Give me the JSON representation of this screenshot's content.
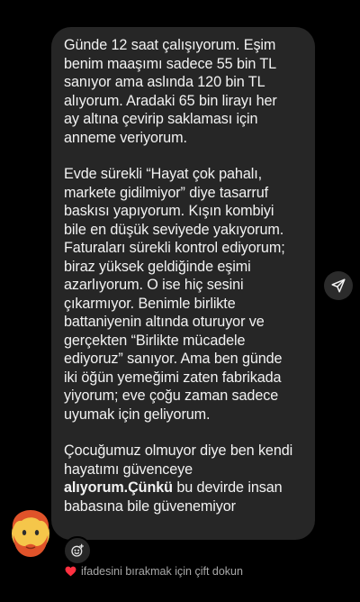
{
  "message": {
    "paragraph1": "Günde 12 saat çalışıyorum. Eşim benim maaşımı sadece 55 bin TL sanıyor ama aslında 120 bin TL alıyorum. Aradaki 65 bin lirayı her ay altına çevirip saklaması için anneme veriyorum.",
    "paragraph2": "Evde sürekli “Hayat çok pahalı, markete gidilmiyor” diye tasarruf baskısı yapıyorum. Kışın kombiyi bile en düşük seviyede yakıyorum. Faturaları sürekli kontrol ediyorum; biraz yüksek geldiğinde eşimi azarlıyorum. O ise hiç sesini çıkarmıyor. Benimle birlikte battaniyenin altında oturuyor ve gerçekten “Birlikte mücadele ediyoruz” sanıyor. Ama ben günde iki öğün yemeğimi zaten fabrikada yiyorum; eve çoğu zaman sadece uyumak için geliyorum.",
    "paragraph3_start": "Çocuğumuz olmuyor diye ben kendi hayatımı güvenceye ",
    "paragraph3_bold": "alıyorum.Çünkü",
    "paragraph3_end": " bu devirde insan babasına bile güvenemiyor"
  },
  "hint": {
    "text": "ifadesini bırakmak için çift dokun"
  },
  "icons": {
    "share": "send-icon",
    "react": "add-reaction-icon",
    "heart": "heart-icon",
    "avatar": "avatar-emoji"
  },
  "colors": {
    "background": "#000000",
    "bubble": "#262626",
    "heart": "#ff3040"
  }
}
